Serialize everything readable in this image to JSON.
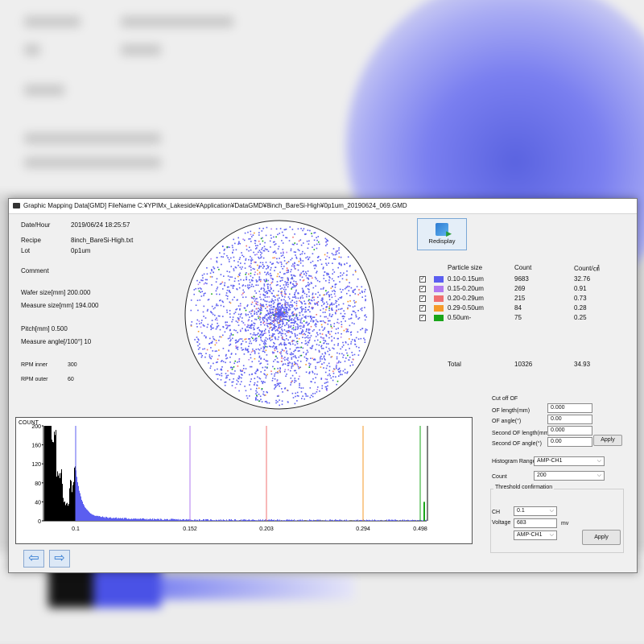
{
  "window": {
    "title": "Graphic Mapping Data[GMD] FileName C:¥YPIMx_Lakeside¥Application¥DataGMD¥8inch_BareSi-High¥0p1um_20190624_069.GMD"
  },
  "info": {
    "date_label": "Date/Hour",
    "date_value": "2019/06/24 18:25:57",
    "recipe_label": "Recipe",
    "recipe_value": "8inch_BareSi-High.txt",
    "lot_label": "Lot",
    "lot_value": "0p1um",
    "comment_label": "Comment",
    "wafer_size": "Wafer size[mm] 200.000",
    "measure_size": "Measure size[mm] 194.000",
    "pitch": "Pitch[mm] 0.500",
    "measure_angle": "Measure angle[/100°] 10",
    "rpm_inner_label": "RPM inner",
    "rpm_inner_value": "300",
    "rpm_outer_label": "RPM outer",
    "rpm_outer_value": "60"
  },
  "redisplay_label": "Redisplay",
  "particle_table": {
    "headers": [
      "Particle size",
      "Count",
      "Count/㎠"
    ],
    "rows": [
      {
        "size": "0.10-0.15um",
        "count": "9683",
        "density": "32.76",
        "color": "#5b5ef0",
        "checked": true
      },
      {
        "size": "0.15-0.20um",
        "count": "269",
        "density": "0.91",
        "color": "#b27af0",
        "checked": true
      },
      {
        "size": "0.20-0.29um",
        "count": "215",
        "density": "0.73",
        "color": "#f07070",
        "checked": true
      },
      {
        "size": "0.29-0.50um",
        "count": "84",
        "density": "0.28",
        "color": "#f59a2a",
        "checked": true
      },
      {
        "size": "0.50um-",
        "count": "75",
        "density": "0.25",
        "color": "#1aa51a",
        "checked": true
      }
    ],
    "total_label": "Total",
    "total_count": "10326",
    "total_density": "34.93"
  },
  "cutoff": {
    "title": "Cut off OF",
    "of_length_label": "OF length(mm)",
    "of_length_value": "0.000",
    "of_angle_label": "OF angle(°)",
    "of_angle_value": "0.00",
    "second_of_length_label": "Second OF length(mm)",
    "second_of_length_value": "0.000",
    "second_of_angle_label": "Second OF angle(°)",
    "second_of_angle_value": "0.00",
    "apply_label": "Apply"
  },
  "histogram_controls": {
    "range_label": "Histogram Range",
    "range_value": "AMP-CH1",
    "count_label": "Count",
    "count_value": "200"
  },
  "threshold": {
    "title": "Threshold confirmation",
    "ch_label": "CH",
    "ch_value": "0.1",
    "voltage_label": "Voltage",
    "voltage_value": "683",
    "voltage_unit": "mv",
    "channel_value": "AMP-CH1",
    "apply_label": "Apply"
  },
  "nav": {
    "back_icon": "arrow-left-icon",
    "forward_icon": "arrow-right-icon"
  },
  "chart_data": {
    "type": "bar",
    "ylabel": "COUNT",
    "ylim": [
      0,
      200
    ],
    "yticks": [
      "200",
      "160",
      "120",
      "80",
      "40",
      "0"
    ],
    "xtick_labels": [
      "0.1",
      "0.152",
      "0.203",
      "0.294",
      "0.498"
    ],
    "thresholds": [
      {
        "label": "0.1",
        "color": "#5b5ef0"
      },
      {
        "label": "0.152",
        "color": "#b27af0"
      },
      {
        "label": "0.203",
        "color": "#f07070"
      },
      {
        "label": "0.294",
        "color": "#f59a2a"
      },
      {
        "label": "0.498",
        "color": "#1aa51a"
      }
    ]
  }
}
